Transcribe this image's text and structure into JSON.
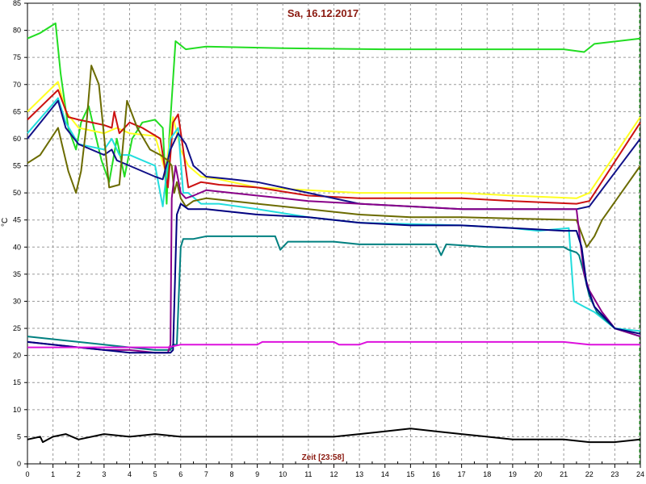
{
  "chart_data": {
    "type": "line",
    "title": "Sa, 16.12.2017",
    "xlabel": "Zeit [23:58]",
    "ylabel": "°C",
    "xlim": [
      0,
      24
    ],
    "ylim": [
      0,
      85
    ],
    "x_ticks": [
      "0",
      "1",
      "2",
      "3",
      "4",
      "5",
      "6",
      "7",
      "8",
      "9",
      "10",
      "11",
      "12",
      "13",
      "14",
      "15",
      "16",
      "17",
      "18",
      "19",
      "20",
      "21",
      "22",
      "23",
      "24"
    ],
    "y_ticks": [
      "0",
      "5",
      "10",
      "15",
      "20",
      "25",
      "30",
      "35",
      "40",
      "45",
      "50",
      "55",
      "60",
      "65",
      "70",
      "75",
      "80",
      "85"
    ],
    "grid": true,
    "series": [
      {
        "color": "#22dd22",
        "points": [
          [
            0,
            78.5
          ],
          [
            0.5,
            79.5
          ],
          [
            1.1,
            81.3
          ],
          [
            1.3,
            72
          ],
          [
            1.6,
            62
          ],
          [
            1.9,
            58
          ],
          [
            2.1,
            63
          ],
          [
            2.4,
            66
          ],
          [
            2.6,
            62
          ],
          [
            2.9,
            56
          ],
          [
            3.2,
            52
          ],
          [
            3.5,
            60
          ],
          [
            3.8,
            53
          ],
          [
            4.1,
            60
          ],
          [
            4.5,
            63
          ],
          [
            5,
            63.5
          ],
          [
            5.3,
            62
          ],
          [
            5.45,
            48
          ],
          [
            5.55,
            60
          ],
          [
            5.8,
            78
          ],
          [
            6.2,
            76.5
          ],
          [
            7,
            77
          ],
          [
            10,
            76.7
          ],
          [
            14,
            76.5
          ],
          [
            21,
            76.5
          ],
          [
            21.8,
            76
          ],
          [
            22.2,
            77.5
          ],
          [
            24,
            78.5
          ]
        ]
      },
      {
        "color": "#ffff22",
        "points": [
          [
            0,
            65
          ],
          [
            1.2,
            70.5
          ],
          [
            1.5,
            65
          ],
          [
            2,
            62
          ],
          [
            3,
            61
          ],
          [
            3.5,
            62
          ],
          [
            4,
            61
          ],
          [
            5,
            60.5
          ],
          [
            5.4,
            54
          ],
          [
            5.7,
            64
          ],
          [
            6,
            58
          ],
          [
            6.3,
            55
          ],
          [
            6.8,
            53
          ],
          [
            7.5,
            52.5
          ],
          [
            9,
            51
          ],
          [
            11,
            50.5
          ],
          [
            13,
            50
          ],
          [
            17,
            50
          ],
          [
            19,
            49.5
          ],
          [
            21.5,
            49
          ],
          [
            22,
            50
          ],
          [
            24,
            64
          ]
        ]
      },
      {
        "color": "#cc1111",
        "points": [
          [
            0,
            63.5
          ],
          [
            1.2,
            69
          ],
          [
            1.6,
            64
          ],
          [
            2,
            63.5
          ],
          [
            3,
            62.5
          ],
          [
            3.3,
            62
          ],
          [
            3.4,
            65
          ],
          [
            3.6,
            61
          ],
          [
            4,
            63
          ],
          [
            4.5,
            62
          ],
          [
            5.2,
            60
          ],
          [
            5.5,
            51
          ],
          [
            5.7,
            63
          ],
          [
            5.9,
            64.5
          ],
          [
            6.1,
            58
          ],
          [
            6.3,
            51
          ],
          [
            6.8,
            52
          ],
          [
            7.5,
            51.5
          ],
          [
            9,
            51
          ],
          [
            11,
            49.5
          ],
          [
            13,
            49
          ],
          [
            17,
            49
          ],
          [
            19,
            48.5
          ],
          [
            21.5,
            48
          ],
          [
            22,
            48.5
          ],
          [
            24,
            63
          ]
        ]
      },
      {
        "color": "#22dddd",
        "points": [
          [
            0,
            61
          ],
          [
            1.2,
            67.5
          ],
          [
            1.5,
            63
          ],
          [
            2,
            59
          ],
          [
            3,
            58
          ],
          [
            3.3,
            60
          ],
          [
            3.6,
            57
          ],
          [
            4,
            57
          ],
          [
            5,
            55
          ],
          [
            5.3,
            47.5
          ],
          [
            5.6,
            60
          ],
          [
            5.9,
            62
          ],
          [
            6.1,
            50
          ],
          [
            6.3,
            50
          ],
          [
            6.8,
            48
          ],
          [
            7.5,
            48
          ],
          [
            9,
            47
          ],
          [
            11,
            45.5
          ],
          [
            13,
            44.5
          ],
          [
            17,
            44
          ],
          [
            19,
            43.5
          ],
          [
            20,
            43
          ],
          [
            21.2,
            43.5
          ],
          [
            21.4,
            30
          ],
          [
            21.8,
            29
          ],
          [
            22.2,
            28
          ],
          [
            23,
            25
          ],
          [
            24,
            24.5
          ]
        ]
      },
      {
        "color": "#111188",
        "points": [
          [
            0,
            60
          ],
          [
            1.2,
            67
          ],
          [
            1.5,
            62
          ],
          [
            2,
            59
          ],
          [
            3,
            57
          ],
          [
            3.3,
            58
          ],
          [
            3.5,
            56
          ],
          [
            4,
            55
          ],
          [
            5,
            53
          ],
          [
            5.3,
            52.5
          ],
          [
            5.6,
            58
          ],
          [
            5.9,
            61
          ],
          [
            6.2,
            59
          ],
          [
            6.5,
            55
          ],
          [
            7,
            53
          ],
          [
            8,
            52.5
          ],
          [
            9,
            52
          ],
          [
            11,
            50
          ],
          [
            13,
            48
          ],
          [
            17,
            47
          ],
          [
            21.5,
            47
          ],
          [
            22,
            47.5
          ],
          [
            24,
            60
          ]
        ]
      },
      {
        "color": "#6b6b00",
        "points": [
          [
            0,
            55.5
          ],
          [
            0.5,
            57
          ],
          [
            1.2,
            62
          ],
          [
            1.6,
            54
          ],
          [
            1.9,
            50
          ],
          [
            2.1,
            54
          ],
          [
            2.3,
            62
          ],
          [
            2.5,
            73.5
          ],
          [
            2.8,
            70
          ],
          [
            3.2,
            51
          ],
          [
            3.6,
            51.5
          ],
          [
            3.9,
            67
          ],
          [
            4.3,
            62
          ],
          [
            4.8,
            58
          ],
          [
            5.2,
            57
          ],
          [
            5.5,
            56
          ],
          [
            5.65,
            55
          ],
          [
            5.75,
            50
          ],
          [
            5.85,
            52
          ],
          [
            6.0,
            49
          ],
          [
            6.2,
            47.5
          ],
          [
            6.5,
            48.5
          ],
          [
            7,
            49
          ],
          [
            9,
            48
          ],
          [
            11,
            47
          ],
          [
            13,
            46
          ],
          [
            15,
            45.5
          ],
          [
            17,
            45.5
          ],
          [
            21.5,
            45
          ],
          [
            21.9,
            40
          ],
          [
            22.2,
            42
          ],
          [
            22.5,
            45
          ],
          [
            24,
            55
          ]
        ]
      },
      {
        "color": "#008080",
        "points": [
          [
            0,
            23.5
          ],
          [
            1,
            23
          ],
          [
            2,
            22.5
          ],
          [
            3,
            22
          ],
          [
            4,
            21.5
          ],
          [
            5,
            21
          ],
          [
            5.6,
            21
          ],
          [
            5.7,
            22
          ],
          [
            5.85,
            22
          ],
          [
            6.0,
            40
          ],
          [
            6.1,
            41.5
          ],
          [
            6.5,
            41.5
          ],
          [
            7,
            42
          ],
          [
            8,
            42
          ],
          [
            9,
            42
          ],
          [
            9.7,
            42
          ],
          [
            9.9,
            39.5
          ],
          [
            10.2,
            41
          ],
          [
            11,
            41
          ],
          [
            12,
            41
          ],
          [
            13,
            40.5
          ],
          [
            14,
            40.5
          ],
          [
            16,
            40.5
          ],
          [
            16.2,
            38.5
          ],
          [
            16.4,
            40.5
          ],
          [
            18,
            40
          ],
          [
            20,
            40
          ],
          [
            21,
            40
          ],
          [
            21.2,
            39.5
          ],
          [
            21.5,
            39
          ],
          [
            21.6,
            38.5
          ],
          [
            21.8,
            35
          ],
          [
            22,
            31
          ],
          [
            22.3,
            28
          ],
          [
            23,
            25
          ],
          [
            24,
            23.5
          ]
        ]
      },
      {
        "color": "#880088",
        "points": [
          [
            0,
            22.5
          ],
          [
            1,
            22
          ],
          [
            2,
            21.5
          ],
          [
            3,
            21
          ],
          [
            4,
            21
          ],
          [
            5,
            20.5
          ],
          [
            5.5,
            20.5
          ],
          [
            5.6,
            22
          ],
          [
            5.65,
            49
          ],
          [
            5.8,
            55
          ],
          [
            6.0,
            50
          ],
          [
            6.2,
            49
          ],
          [
            6.5,
            49.5
          ],
          [
            7,
            50.5
          ],
          [
            8,
            50
          ],
          [
            9,
            49.5
          ],
          [
            10,
            49
          ],
          [
            11,
            48.5
          ],
          [
            13,
            48
          ],
          [
            15,
            47.5
          ],
          [
            17,
            47
          ],
          [
            21.5,
            47
          ],
          [
            21.6,
            43
          ],
          [
            21.8,
            35
          ],
          [
            22,
            32
          ],
          [
            22.5,
            28
          ],
          [
            23,
            25
          ],
          [
            24,
            23.5
          ]
        ]
      },
      {
        "color": "#000080",
        "points": [
          [
            0,
            22.5
          ],
          [
            1,
            22
          ],
          [
            2,
            21.5
          ],
          [
            3,
            21
          ],
          [
            4,
            20.5
          ],
          [
            5,
            20.5
          ],
          [
            5.6,
            20.5
          ],
          [
            5.7,
            21
          ],
          [
            5.85,
            46
          ],
          [
            6.0,
            48
          ],
          [
            6.3,
            47
          ],
          [
            7,
            47
          ],
          [
            9,
            46
          ],
          [
            11,
            45.5
          ],
          [
            13,
            44.5
          ],
          [
            15,
            44
          ],
          [
            17,
            44
          ],
          [
            19,
            43.5
          ],
          [
            21,
            43
          ],
          [
            21.5,
            43
          ],
          [
            21.7,
            40
          ],
          [
            21.9,
            33
          ],
          [
            22.2,
            29
          ],
          [
            22.6,
            27
          ],
          [
            23,
            25
          ],
          [
            24,
            24
          ]
        ]
      },
      {
        "color": "#dd11dd",
        "points": [
          [
            0,
            21.5
          ],
          [
            5.5,
            21.5
          ],
          [
            6,
            22
          ],
          [
            9,
            22
          ],
          [
            9.2,
            22.5
          ],
          [
            12,
            22.5
          ],
          [
            12.2,
            22
          ],
          [
            13,
            22
          ],
          [
            13.3,
            22.5
          ],
          [
            14,
            22.5
          ],
          [
            16,
            22.5
          ],
          [
            19,
            22.5
          ],
          [
            21,
            22.5
          ],
          [
            22,
            22
          ],
          [
            24,
            22
          ]
        ]
      },
      {
        "color": "#000000",
        "points": [
          [
            0,
            4.5
          ],
          [
            0.5,
            5
          ],
          [
            0.6,
            4
          ],
          [
            1,
            5
          ],
          [
            1.5,
            5.5
          ],
          [
            2,
            4.5
          ],
          [
            3,
            5.5
          ],
          [
            4,
            5
          ],
          [
            5,
            5.5
          ],
          [
            6,
            5
          ],
          [
            8,
            5
          ],
          [
            10,
            5
          ],
          [
            11,
            5
          ],
          [
            12,
            5
          ],
          [
            13,
            5.5
          ],
          [
            14,
            6
          ],
          [
            15,
            6.5
          ],
          [
            16,
            6
          ],
          [
            17,
            5.5
          ],
          [
            18,
            5
          ],
          [
            19,
            4.5
          ],
          [
            20,
            4.5
          ],
          [
            21,
            4.5
          ],
          [
            22,
            4
          ],
          [
            23,
            4
          ],
          [
            24,
            4.5
          ]
        ]
      }
    ]
  }
}
